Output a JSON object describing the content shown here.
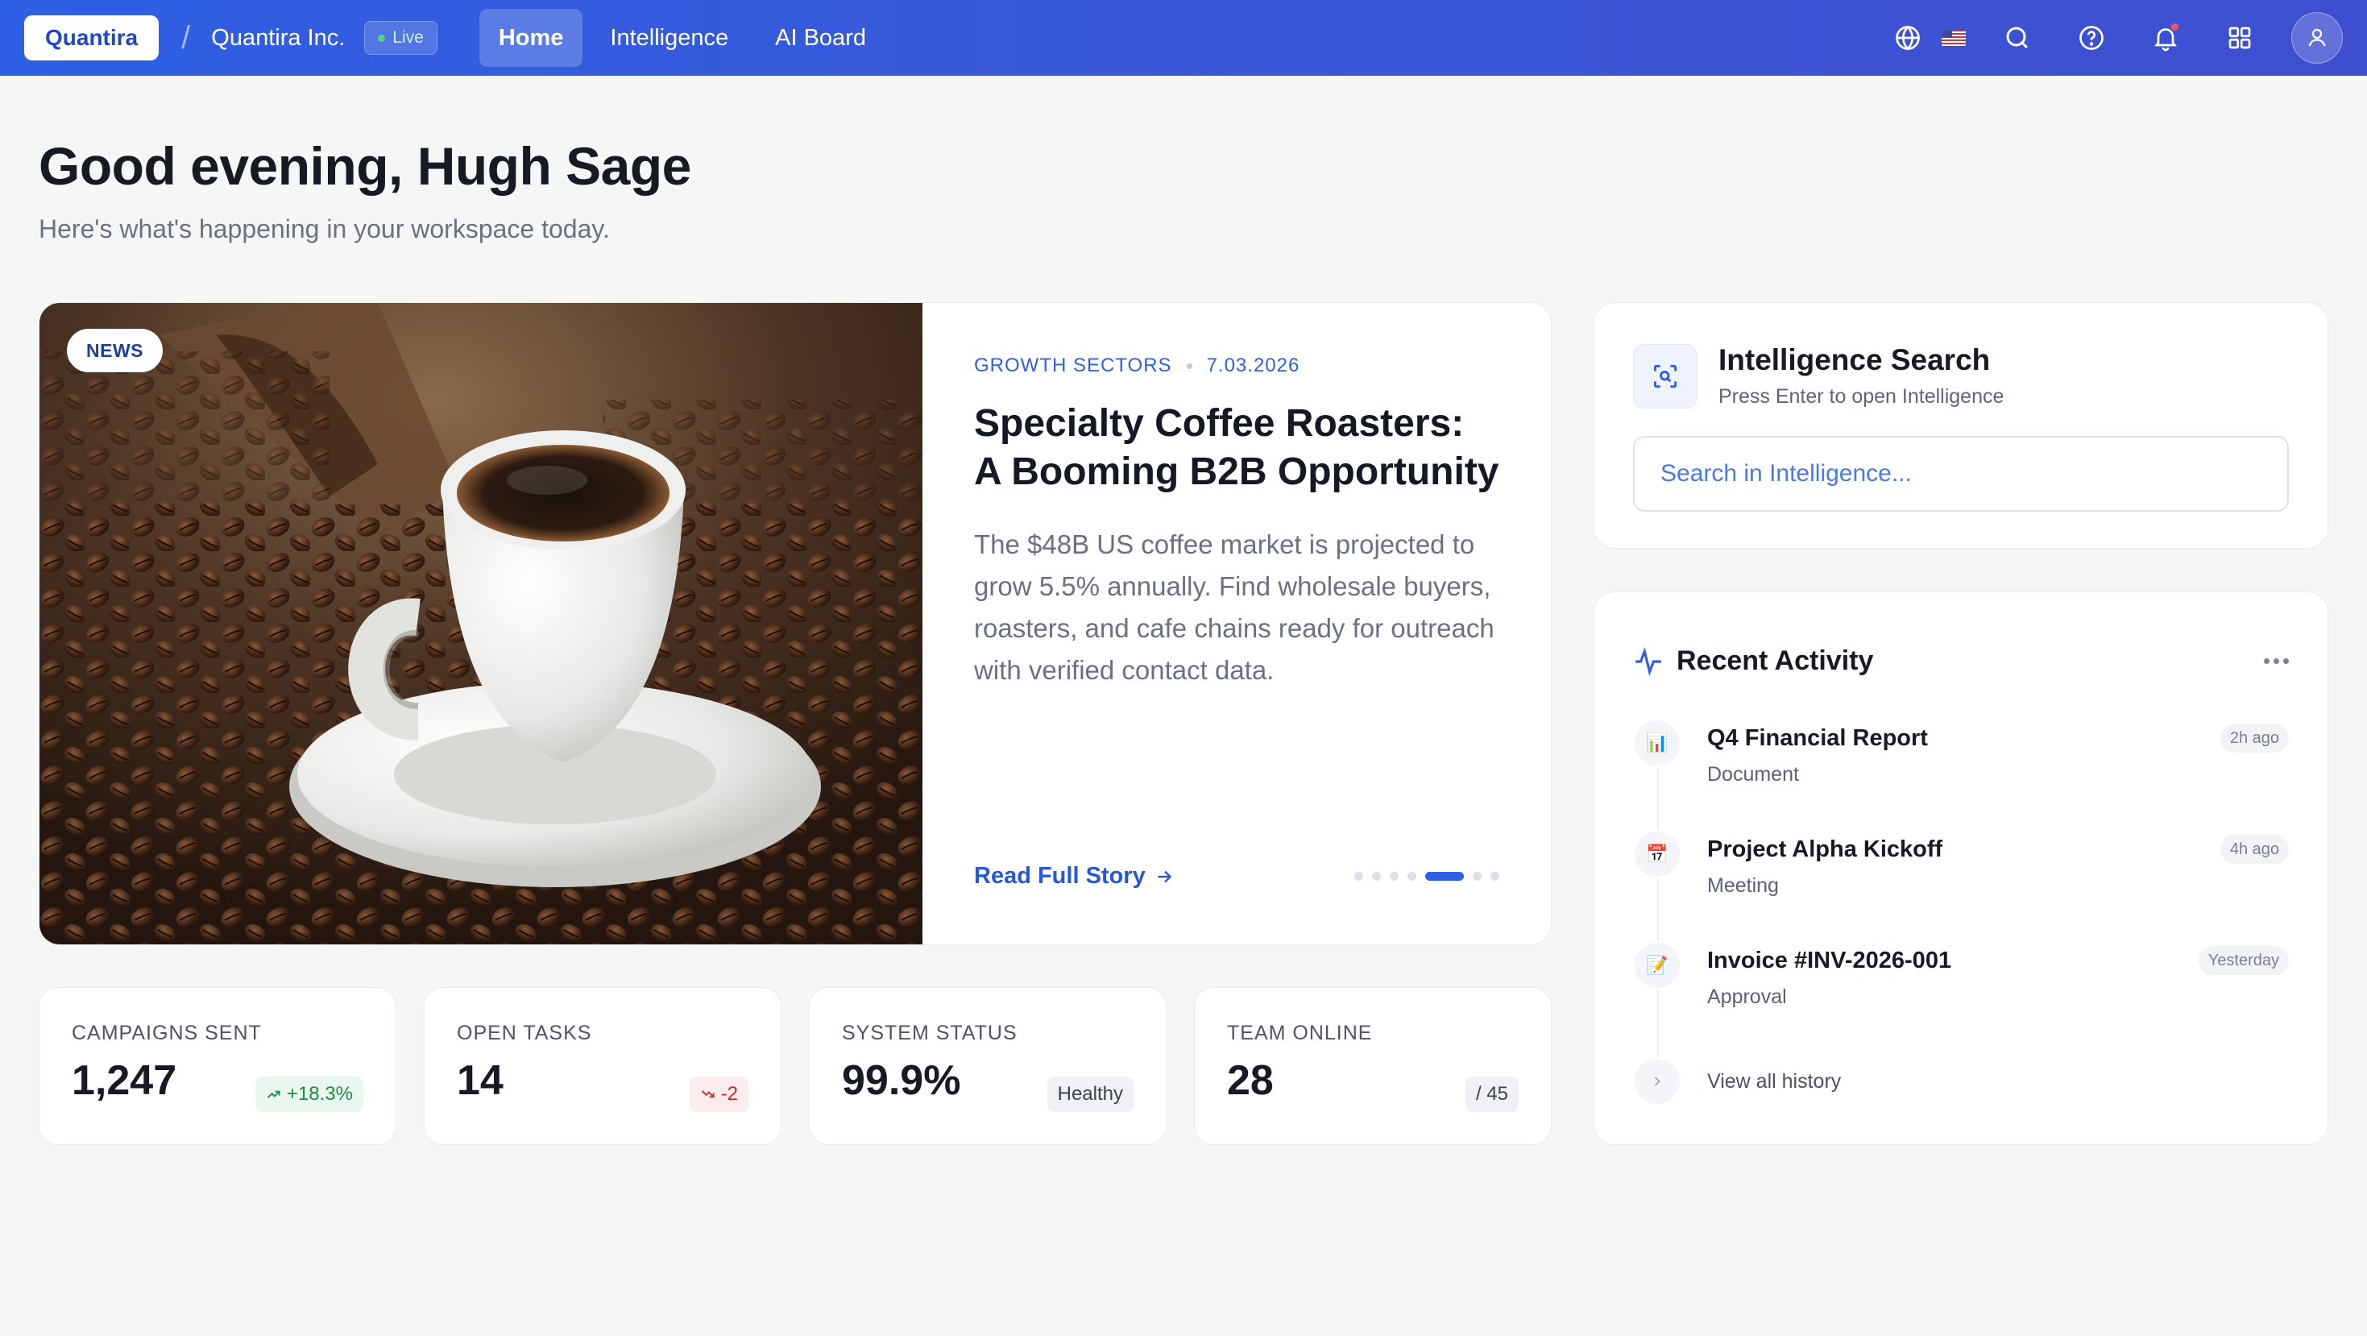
{
  "nav": {
    "brand": "Quantira",
    "separator": "/",
    "org": "Quantira Inc.",
    "status": "Live",
    "tabs": [
      {
        "label": "Home",
        "active": true
      },
      {
        "label": "Intelligence",
        "active": false
      },
      {
        "label": "AI Board",
        "active": false
      }
    ],
    "icons": [
      "globe-icon",
      "us-flag-icon",
      "search-icon",
      "help-icon",
      "bell-icon",
      "apps-grid-icon",
      "user-icon"
    ],
    "has_notification": true
  },
  "greeting": {
    "title": "Good evening, Hugh Sage",
    "subtitle": "Here's what's happening in your workspace today."
  },
  "news": {
    "tag": "NEWS",
    "category": "GROWTH SECTORS",
    "date": "7.03.2026",
    "title": "Specialty Coffee Roasters: A Booming B2B Opportunity",
    "description": "The $48B US coffee market is projected to grow 5.5% annually. Find wholesale buyers, roasters, and cafe chains ready for outreach with verified contact data.",
    "cta": "Read Full Story",
    "slides_total": 7,
    "active_slide": 5
  },
  "stats": [
    {
      "label": "CAMPAIGNS SENT",
      "value": "1,247",
      "badge": "+18.3%",
      "badge_type": "up"
    },
    {
      "label": "OPEN TASKS",
      "value": "14",
      "badge": "-2",
      "badge_type": "down"
    },
    {
      "label": "SYSTEM STATUS",
      "value": "99.9%",
      "badge": "Healthy",
      "badge_type": "neutral"
    },
    {
      "label": "TEAM ONLINE",
      "value": "28",
      "badge": "/ 45",
      "badge_type": "neutral"
    }
  ],
  "search": {
    "title": "Intelligence Search",
    "subtitle": "Press Enter to open Intelligence",
    "placeholder": "Search in Intelligence..."
  },
  "activity": {
    "title": "Recent Activity",
    "items": [
      {
        "title": "Q4 Financial Report",
        "type": "Document",
        "time": "2h ago",
        "icon": "📊"
      },
      {
        "title": "Project Alpha Kickoff",
        "type": "Meeting",
        "time": "4h ago",
        "icon": "📅"
      },
      {
        "title": "Invoice #INV-2026-001",
        "type": "Approval",
        "time": "Yesterday",
        "icon": "📝"
      }
    ],
    "view_all": "View all history"
  },
  "colors": {
    "accent": "#2f5fe3",
    "background": "#f5f6f6",
    "positive": "#1e8a45",
    "negative": "#cc2b2b"
  }
}
